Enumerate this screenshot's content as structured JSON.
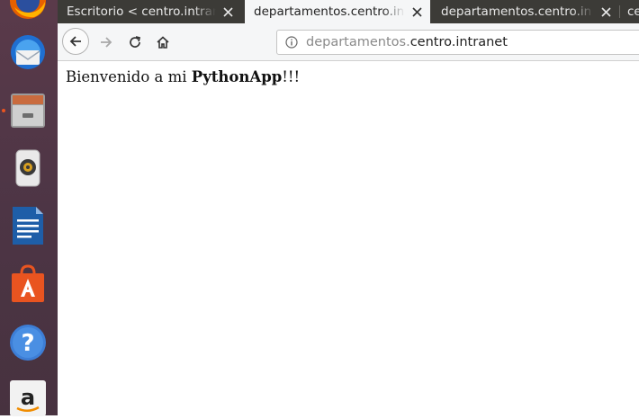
{
  "tabs": [
    {
      "label": "Escritorio < centro.intran",
      "active": false
    },
    {
      "label": "departamentos.centro.in",
      "active": true
    },
    {
      "label": "departamentos.centro.in",
      "active": false
    },
    {
      "label": "ce",
      "active": false
    }
  ],
  "navbar": {
    "url_prefix": "departamentos.",
    "url_domain": "centro.intranet"
  },
  "page": {
    "text_before": "Bienvenido a mi ",
    "text_bold": "PythonApp",
    "text_after": "!!!"
  },
  "launcher": {
    "items": [
      "firefox-icon",
      "thunderbird-icon",
      "files-icon",
      "rhythmbox-icon",
      "libreoffice-writer-icon",
      "software-center-icon",
      "help-icon",
      "amazon-icon"
    ]
  },
  "colors": {
    "launcher_bg": "#4d3545",
    "tabbar_bg": "#3c3b37",
    "active_tab_bg": "#f5f6f7",
    "ubuntu_orange": "#e95420"
  }
}
